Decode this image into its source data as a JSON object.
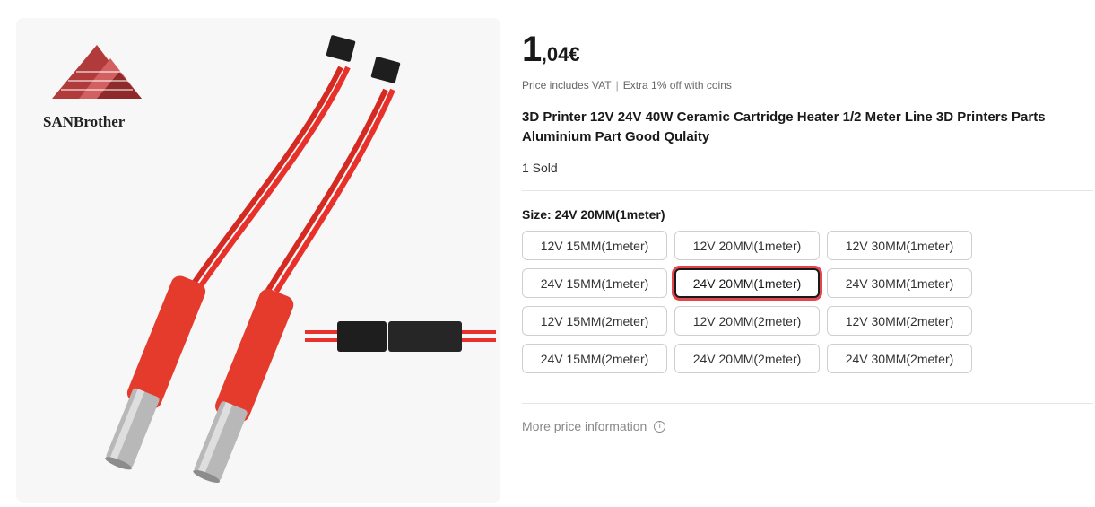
{
  "product": {
    "brand_logo_text": "SANBrother",
    "price": {
      "integer": "1",
      "decimal": ",04",
      "currency": "€"
    },
    "vat_note": "Price includes VAT",
    "coin_note": "Extra 1% off with coins",
    "title": "3D Printer 12V 24V 40W Ceramic Cartridge Heater 1/2 Meter Line 3D Printers Parts Aluminium Part Good Qulaity",
    "sold": "1 Sold",
    "size_label": "Size: 24V 20MM(1meter)",
    "sizes": [
      "12V 15MM(1meter)",
      "12V 20MM(1meter)",
      "12V 30MM(1meter)",
      "24V 15MM(1meter)",
      "24V 20MM(1meter)",
      "24V 30MM(1meter)",
      "12V 15MM(2meter)",
      "12V 20MM(2meter)",
      "12V 30MM(2meter)",
      "24V 15MM(2meter)",
      "24V 20MM(2meter)",
      "24V 30MM(2meter)"
    ],
    "selected_size": "24V 20MM(1meter)",
    "more_price_info": "More price information"
  },
  "colors": {
    "accent_red": "#e2474b",
    "wire_red": "#e8312a"
  }
}
